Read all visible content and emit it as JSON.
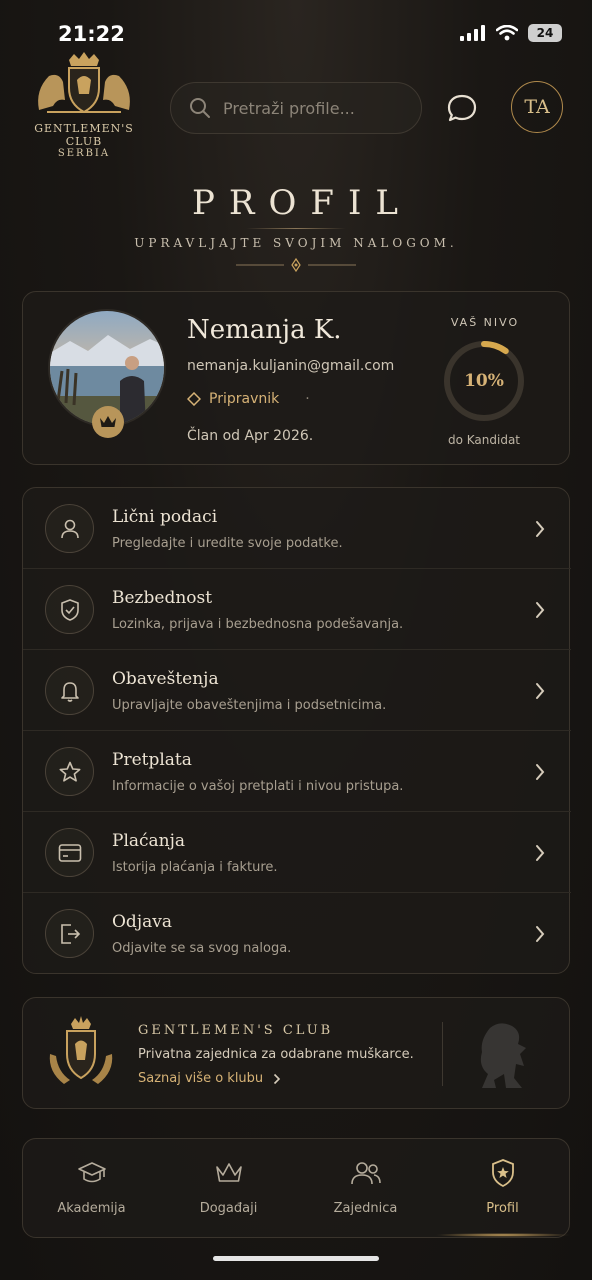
{
  "status": {
    "time": "21:22",
    "battery": "24"
  },
  "header": {
    "logo_title": "GENTLEMEN'S CLUB",
    "logo_sub": "SERBIA",
    "search_placeholder": "Pretraži profile...",
    "avatar_initials": "TA"
  },
  "page": {
    "title": "PROFIL",
    "subtitle": "UPRAVLJAJTE SVOJIM NALOGOM."
  },
  "profile": {
    "name": "Nemanja K.",
    "email": "nemanja.kuljanin@gmail.com",
    "rank": "Pripravnik",
    "separator": "·",
    "member_since": "Član od Apr 2026.",
    "level_label": "VAŠ NIVO",
    "level_percent": "10%",
    "level_progress": 0.1,
    "level_next": "do Kandidat"
  },
  "menu": [
    {
      "title": "Lični podaci",
      "desc": "Pregledajte i uredite svoje podatke.",
      "icon": "user-icon"
    },
    {
      "title": "Bezbednost",
      "desc": "Lozinka, prijava i bezbednosna podešavanja.",
      "icon": "shield-check-icon"
    },
    {
      "title": "Obaveštenja",
      "desc": "Upravljajte obaveštenjima i podsetnicima.",
      "icon": "bell-icon"
    },
    {
      "title": "Pretplata",
      "desc": "Informacije o vašoj pretplati i nivou pristupa.",
      "icon": "star-icon"
    },
    {
      "title": "Plaćanja",
      "desc": "Istorija plaćanja i fakture.",
      "icon": "credit-card-icon"
    },
    {
      "title": "Odjava",
      "desc": "Odjavite se sa svog naloga.",
      "icon": "logout-icon"
    }
  ],
  "club": {
    "title": "GENTLEMEN'S CLUB",
    "desc": "Privatna zajednica za odabrane muškarce.",
    "link": "Saznaj više o klubu"
  },
  "nav": [
    {
      "label": "Akademija",
      "icon": "graduation-cap-icon",
      "active": false
    },
    {
      "label": "Događaji",
      "icon": "crown-icon",
      "active": false
    },
    {
      "label": "Zajednica",
      "icon": "users-icon",
      "active": false
    },
    {
      "label": "Profil",
      "icon": "shield-star-icon",
      "active": true
    }
  ],
  "colors": {
    "accent": "#d6b276",
    "background": "#1a1714",
    "text": "#ece3d3"
  }
}
